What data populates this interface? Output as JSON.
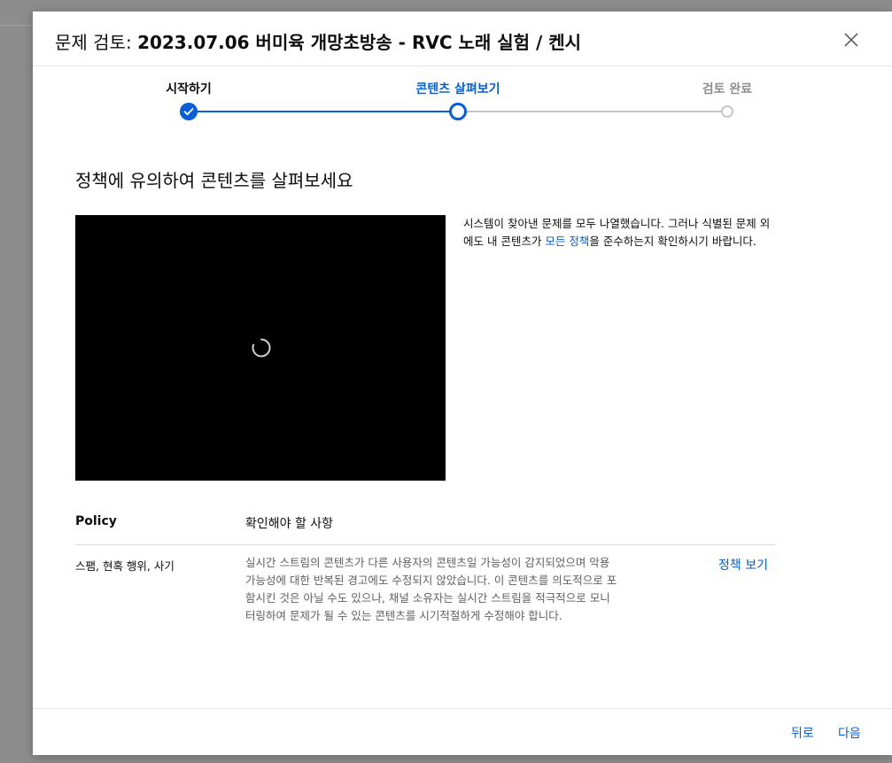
{
  "dialog": {
    "title_prefix": "문제 검토: ",
    "title_name": "2023.07.06 버미육 개망초방송 - RVC 노래 실험 / 켄시",
    "close_icon": "close-icon"
  },
  "stepper": {
    "steps": [
      {
        "label": "시작하기",
        "state": "done"
      },
      {
        "label": "콘텐츠 살펴보기",
        "state": "active"
      },
      {
        "label": "검토 완료",
        "state": "todo"
      }
    ],
    "accent": "#065fd4",
    "inactive": "#c6c6c6"
  },
  "main": {
    "heading": "정책에 유의하여 콘텐츠를 살펴보세요",
    "info_part1": "시스템이 찾아낸 문제를 모두 나열했습니다. 그러나 식별된 문제 외에도 내 콘텐츠가 ",
    "info_link": "모든 정책",
    "info_part2": "을 준수하는지 확인하시기 바랍니다."
  },
  "table": {
    "headers": {
      "policy": "Policy",
      "check": "확인해야 할 사항"
    },
    "rows": [
      {
        "policy": "스팸, 현혹 행위, 사기",
        "description": "실시간 스트림의 콘텐츠가 다른 사용자의 콘텐츠일 가능성이 감지되었으며 악용 가능성에 대한 반복된 경고에도 수정되지 않았습니다. 이 콘텐츠를 의도적으로 포함시킨 것은 아닐 수도 있으나, 채널 소유자는 실시간 스트림을 적극적으로 모니터링하여 문제가 될 수 있는 콘텐츠를 시기적절하게 수정해야 합니다.",
        "link": "정책 보기"
      }
    ]
  },
  "footer": {
    "back_label": "뒤로",
    "next_label": "다음"
  }
}
